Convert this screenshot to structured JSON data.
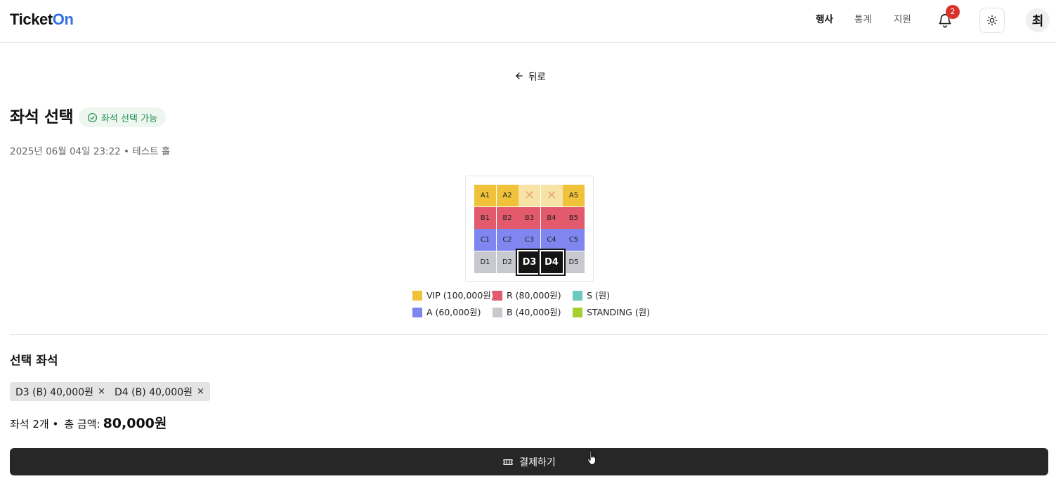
{
  "header": {
    "logo_part1": "Ticket",
    "logo_part2": "On",
    "nav": [
      "행사",
      "통계",
      "지원"
    ],
    "notification_count": "2",
    "avatar_initial": "최"
  },
  "back_label": "뒤로",
  "page": {
    "title": "좌석 선택",
    "status_badge": "좌석 선택 가능",
    "event_meta": "2025년 06월 04일 23:22 • 테스트 홀"
  },
  "seat_map": {
    "rows": [
      [
        {
          "label": "A1",
          "grade": "vip"
        },
        {
          "label": "A2",
          "grade": "vip"
        },
        {
          "label": "✕",
          "grade": "sold"
        },
        {
          "label": "✕",
          "grade": "sold"
        },
        {
          "label": "A5",
          "grade": "vip"
        }
      ],
      [
        {
          "label": "B1",
          "grade": "r"
        },
        {
          "label": "B2",
          "grade": "r"
        },
        {
          "label": "B3",
          "grade": "r"
        },
        {
          "label": "B4",
          "grade": "r"
        },
        {
          "label": "B5",
          "grade": "r"
        }
      ],
      [
        {
          "label": "C1",
          "grade": "a"
        },
        {
          "label": "C2",
          "grade": "a"
        },
        {
          "label": "C3",
          "grade": "a"
        },
        {
          "label": "C4",
          "grade": "a"
        },
        {
          "label": "C5",
          "grade": "a"
        }
      ],
      [
        {
          "label": "D1",
          "grade": "b"
        },
        {
          "label": "D2",
          "grade": "b"
        },
        {
          "label": "D3",
          "grade": "selected"
        },
        {
          "label": "D4",
          "grade": "selected"
        },
        {
          "label": "D5",
          "grade": "b"
        }
      ]
    ]
  },
  "legend": [
    {
      "label": "VIP (100,000원)",
      "color": "#efc23a"
    },
    {
      "label": "R (80,000원)",
      "color": "#e25a6c"
    },
    {
      "label": "S (원)",
      "color": "#6cc9bd"
    },
    {
      "label": "A (60,000원)",
      "color": "#7f86ef"
    },
    {
      "label": "B (40,000원)",
      "color": "#c7c9cf"
    },
    {
      "label": "STANDING (원)",
      "color": "#a4cf2e"
    }
  ],
  "selection": {
    "title": "선택 좌석",
    "chips": [
      {
        "label": "D3 (B) 40,000원",
        "remove": "×"
      },
      {
        "label": "D4 (B) 40,000원",
        "remove": "×"
      }
    ],
    "count_text": "좌석 2개 •",
    "total_label": "총 금액:",
    "total_value": "80,000원"
  },
  "pay_button": "결제하기"
}
